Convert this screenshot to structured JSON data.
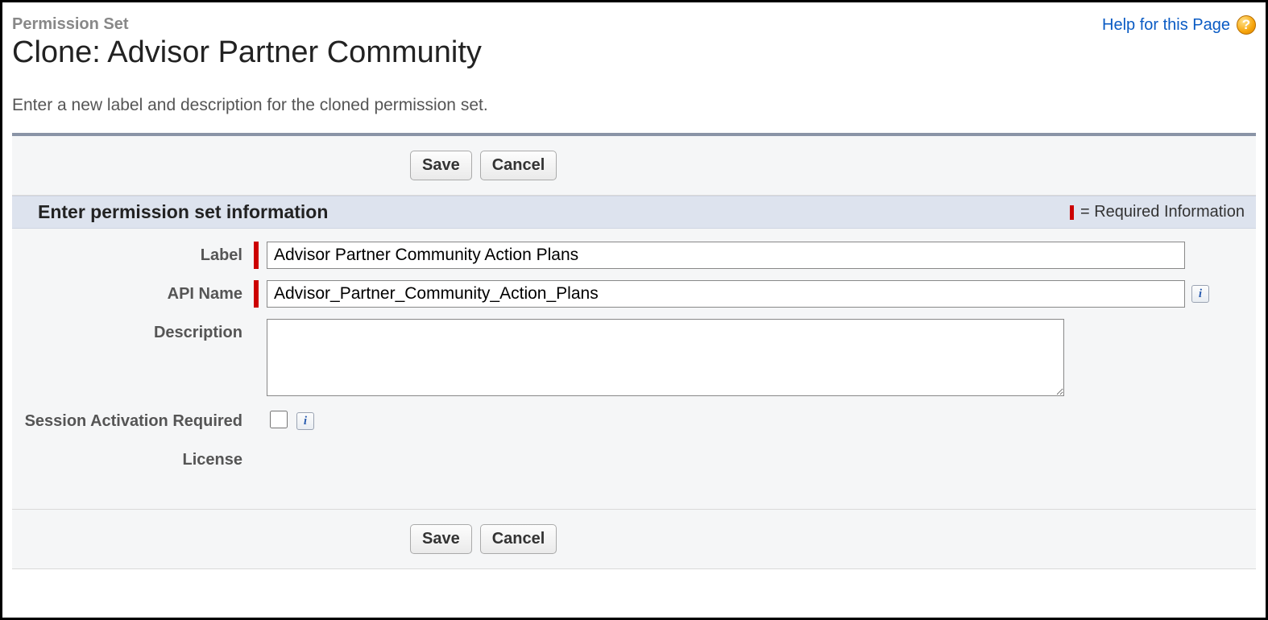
{
  "header": {
    "crumb": "Permission Set",
    "title": "Clone: Advisor Partner Community",
    "help_link_label": "Help for this Page"
  },
  "instructions": "Enter a new label and description for the cloned permission set.",
  "buttons": {
    "save": "Save",
    "cancel": "Cancel"
  },
  "section": {
    "title": "Enter permission set information",
    "required_note": "= Required Information"
  },
  "fields": {
    "label": {
      "label": "Label",
      "value": "Advisor Partner Community Action Plans"
    },
    "api_name": {
      "label": "API Name",
      "value": "Advisor_Partner_Community_Action_Plans"
    },
    "description": {
      "label": "Description",
      "value": ""
    },
    "session_activation": {
      "label": "Session Activation Required",
      "checked": false
    },
    "license": {
      "label": "License",
      "value": ""
    }
  }
}
